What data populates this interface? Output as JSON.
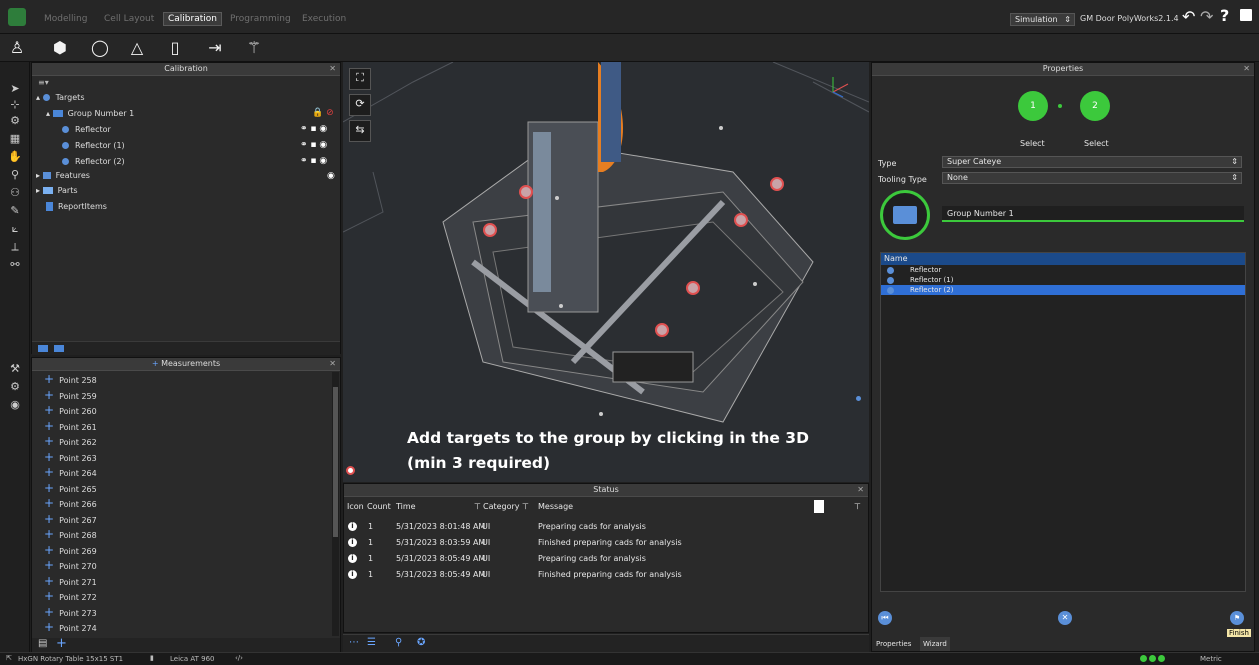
{
  "menu": {
    "tabs": [
      "Modelling",
      "Cell Layout",
      "Calibration",
      "Programming",
      "Execution"
    ],
    "active_tab": "Calibration"
  },
  "topright": {
    "mode": "Simulation",
    "project": "GM Door PolyWorks2.1.4"
  },
  "toolbar_icons": [
    "robot-icon",
    "cube-icon",
    "sphere-icon",
    "cone-icon",
    "cylinder-icon",
    "import-icon",
    "wand-icon"
  ],
  "left_strip_icons": [
    "pointer-icon",
    "measure-icon",
    "robot-arm-icon",
    "grid-icon",
    "hand-icon",
    "probe-icon",
    "group-icon",
    "pen-icon",
    "align-icon",
    "axis-icon",
    "transform-icon",
    "tool-icon",
    "settings-icon",
    "camera-icon"
  ],
  "calibration_panel": {
    "title": "Calibration",
    "tree": [
      {
        "label": "Targets",
        "level": 0,
        "kind": "dot"
      },
      {
        "label": "Group Number 1",
        "level": 1,
        "kind": "folder"
      },
      {
        "label": "Reflector",
        "level": 2,
        "kind": "dot"
      },
      {
        "label": "Reflector (1)",
        "level": 2,
        "kind": "dot"
      },
      {
        "label": "Reflector (2)",
        "level": 2,
        "kind": "dot"
      },
      {
        "label": "Features",
        "level": 0,
        "kind": "list"
      },
      {
        "label": "Parts",
        "level": 0,
        "kind": "part"
      },
      {
        "label": "ReportItems",
        "level": 0,
        "kind": "report"
      }
    ]
  },
  "measurements_panel": {
    "title": "Measurements",
    "items": [
      "Point 258",
      "Point 259",
      "Point 260",
      "Point 261",
      "Point 262",
      "Point 263",
      "Point 264",
      "Point 265",
      "Point 266",
      "Point 267",
      "Point 268",
      "Point 269",
      "Point 270",
      "Point 271",
      "Point 272",
      "Point 273",
      "Point 274"
    ]
  },
  "viewport": {
    "instruction_line1": "Add targets to the group by clicking in the 3D",
    "instruction_line2": "(min 3 required)"
  },
  "status_panel": {
    "title": "Status",
    "headers": {
      "icon": "Icon",
      "count": "Count",
      "time": "Time",
      "category": "Category",
      "message": "Message"
    },
    "rows": [
      {
        "count": "1",
        "time": "5/31/2023 8:01:48 AM",
        "category": "UI",
        "message": "Preparing cads for analysis"
      },
      {
        "count": "1",
        "time": "5/31/2023 8:03:59 AM",
        "category": "UI",
        "message": "Finished preparing cads for analysis"
      },
      {
        "count": "1",
        "time": "5/31/2023 8:05:49 AM",
        "category": "UI",
        "message": "Preparing cads for analysis"
      },
      {
        "count": "1",
        "time": "5/31/2023 8:05:49 AM",
        "category": "UI",
        "message": "Finished preparing cads for analysis"
      }
    ]
  },
  "properties_panel": {
    "title": "Properties",
    "steps": [
      {
        "num": "1",
        "label": "Select"
      },
      {
        "num": "2",
        "label": "Select"
      }
    ],
    "type_label": "Type",
    "type_value": "Super Cateye",
    "tooling_label": "Tooling Type",
    "tooling_value": "None",
    "group_name": "Group Number 1",
    "list_header": "Name",
    "list_items": [
      "Reflector",
      "Reflector (1)",
      "Reflector (2)"
    ],
    "bottom_tabs": [
      "Properties",
      "Wizard"
    ],
    "finish_label": "Finish"
  },
  "statusbar": {
    "table": "HxGN Rotary Table 15x15 ST1",
    "tracker": "Leica AT 960",
    "units": "Metric"
  },
  "colors": {
    "accent_green": "#3cc93c",
    "selection_blue": "#2f6fd6",
    "header_blue": "#1b4a8a"
  }
}
